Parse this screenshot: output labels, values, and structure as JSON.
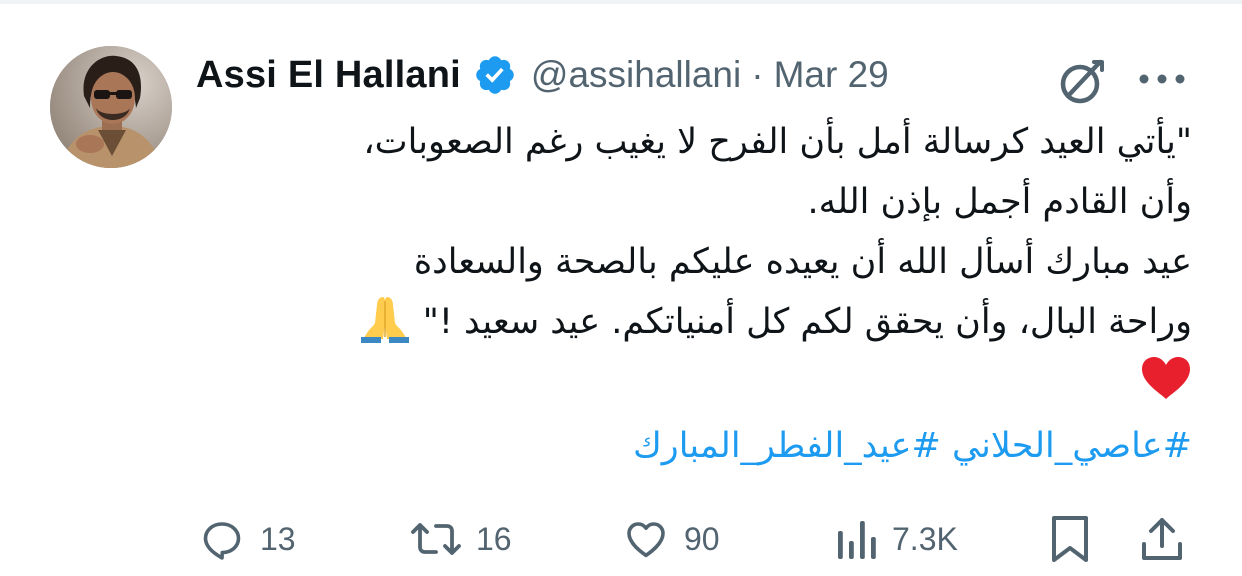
{
  "tweet": {
    "author": {
      "display_name": "Assi El Hallani",
      "handle": "@assihallani",
      "verified": true
    },
    "separator": "·",
    "date": "Mar 29",
    "text_lines": [
      "\"يأتي العيد كرسالة أمل بأن الفرح لا يغيب رغم الصعوبات،",
      "وأن القادم أجمل بإذن الله.",
      "عيد مبارك أسأل الله أن يعيده عليكم بالصحة والسعادة",
      "وراحة البال، وأن يحقق لكم كل أمنياتكم. عيد سعيد !\""
    ],
    "emojis": [
      "folded-hands",
      "red-heart"
    ],
    "hashtags": [
      "#عاصي_الحلاني",
      "#عيد_الفطر_المبارك"
    ],
    "actions": {
      "replies": "13",
      "reposts": "16",
      "likes": "90",
      "views": "7.3K"
    }
  },
  "colors": {
    "text": "#0f1419",
    "secondary": "#536471",
    "link": "#1d9bf0",
    "verified_badge": "#1d9bf0",
    "heart": "#e8202e"
  },
  "icons": [
    "grok-icon",
    "more-icon",
    "verified-badge-icon",
    "reply-icon",
    "repost-icon",
    "like-icon",
    "views-icon",
    "bookmark-icon",
    "share-icon"
  ]
}
